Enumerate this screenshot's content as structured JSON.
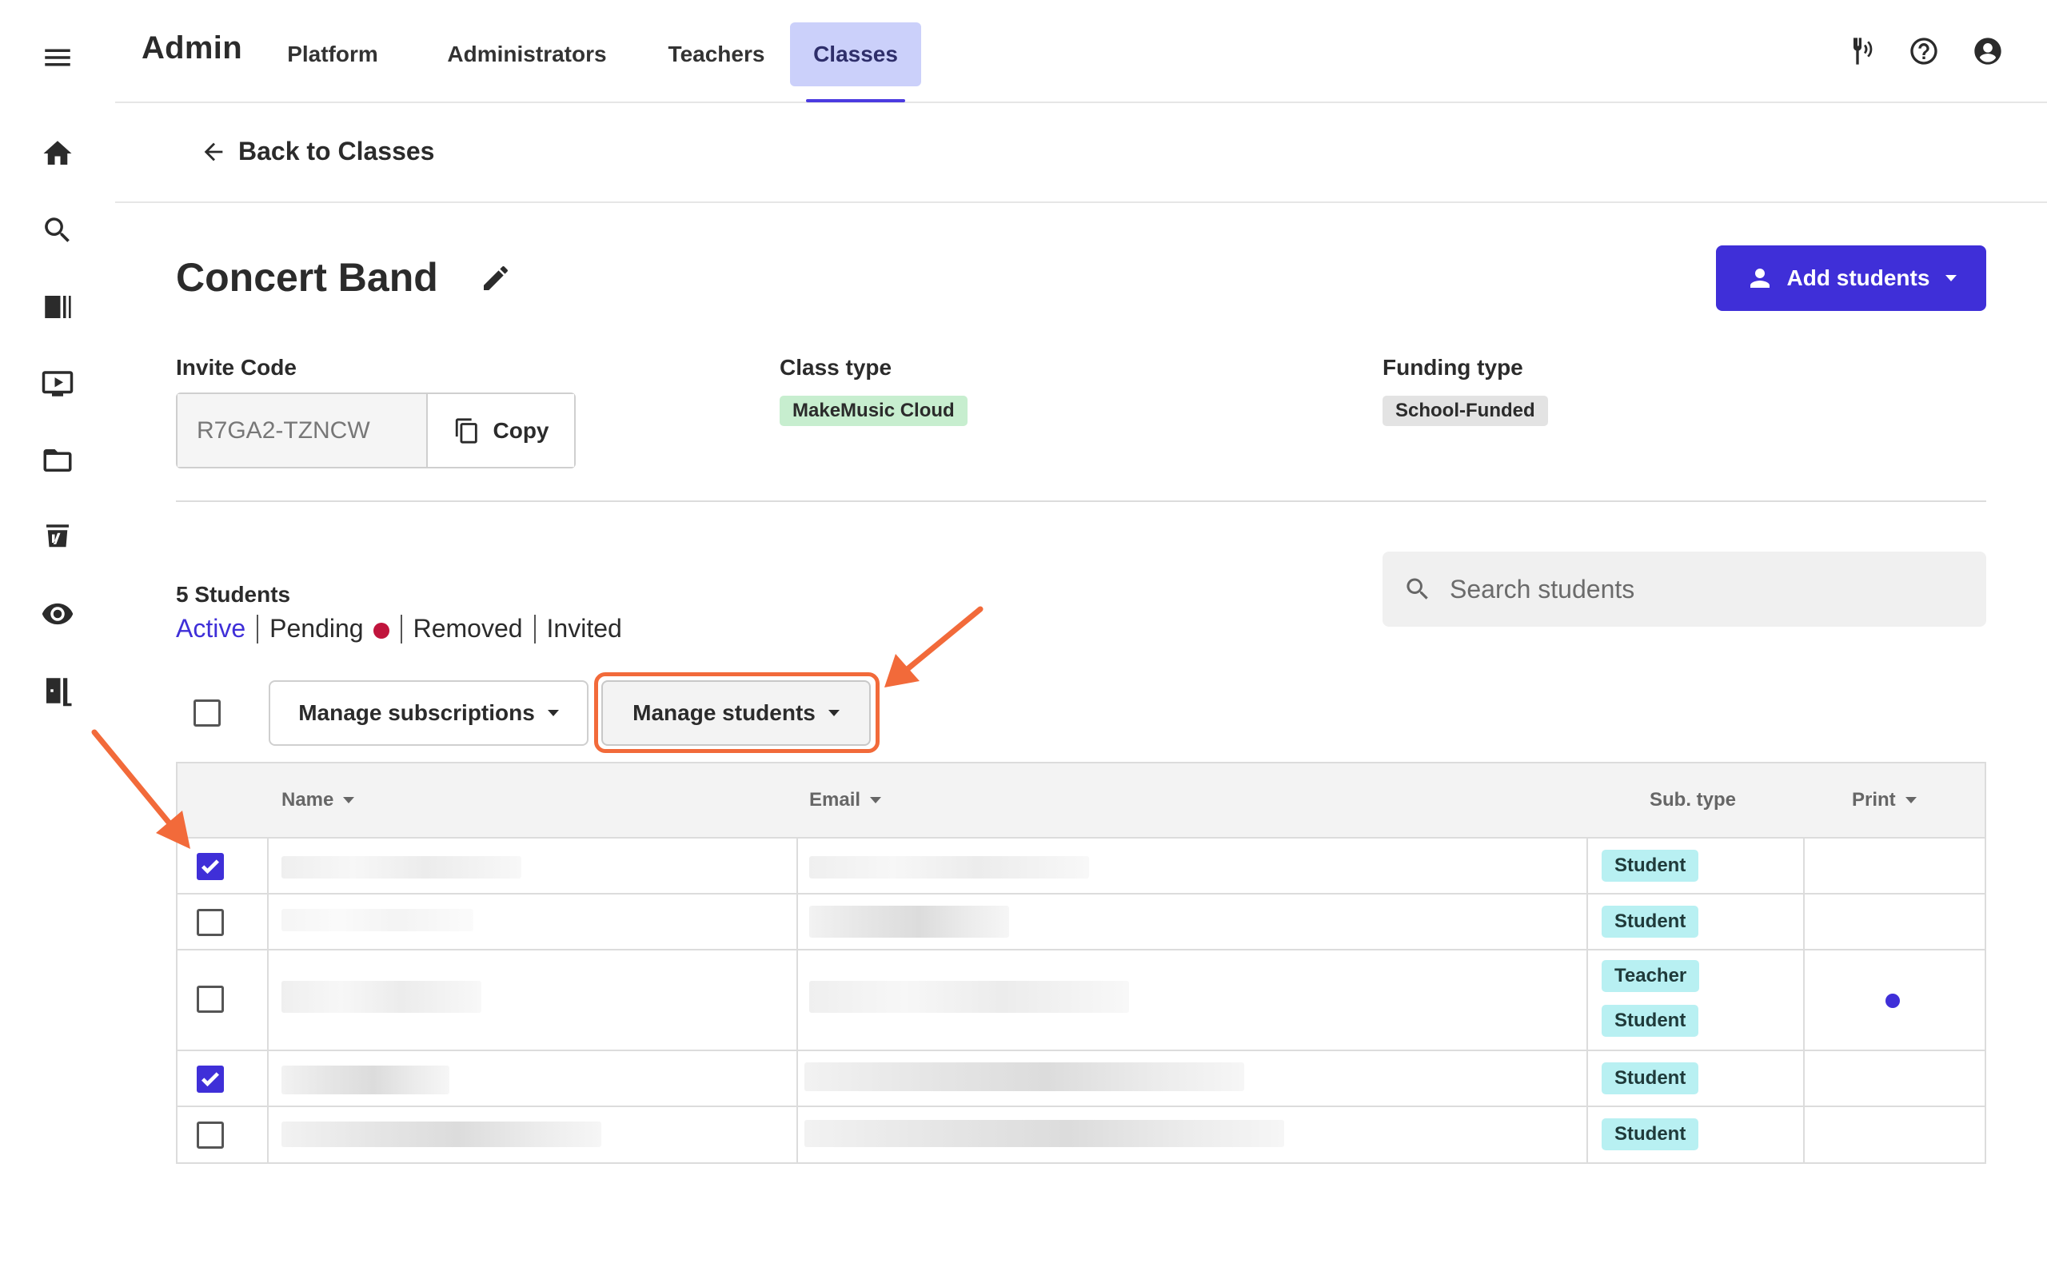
{
  "app": {
    "title": "Admin"
  },
  "nav": {
    "tabs": [
      {
        "label": "Platform"
      },
      {
        "label": "Administrators"
      },
      {
        "label": "Teachers"
      },
      {
        "label": "Classes",
        "active": true
      }
    ]
  },
  "rail": {
    "items": [
      "menu-icon",
      "home-icon",
      "search-icon",
      "library-icon",
      "video-icon",
      "folder-icon",
      "assignment-icon",
      "eye-icon",
      "exit-icon"
    ]
  },
  "top_icons": [
    "tuner-icon",
    "help-icon",
    "account-icon"
  ],
  "back": {
    "label": "Back to Classes"
  },
  "class": {
    "name": "Concert Band",
    "invite_code_label": "Invite Code",
    "invite_code": "R7GA2-TZNCW",
    "copy_label": "Copy",
    "class_type_label": "Class type",
    "class_type": "MakeMusic Cloud",
    "funding_type_label": "Funding type",
    "funding_type": "School-Funded"
  },
  "add_students": {
    "label": "Add students"
  },
  "students": {
    "count_label": "5 Students",
    "filters": [
      "Active",
      "Pending",
      "Removed",
      "Invited"
    ],
    "active_filter": "Active",
    "search_placeholder": "Search students"
  },
  "toolbar": {
    "manage_subscriptions": "Manage subscriptions",
    "manage_students": "Manage students"
  },
  "table": {
    "columns": {
      "name": "Name",
      "email": "Email",
      "sub_type": "Sub. type",
      "print": "Print"
    },
    "rows": [
      {
        "checked": true,
        "sub_types": [
          "Student"
        ],
        "print": false
      },
      {
        "checked": false,
        "sub_types": [
          "Student"
        ],
        "print": false
      },
      {
        "checked": false,
        "sub_types": [
          "Teacher",
          "Student"
        ],
        "print": true
      },
      {
        "checked": true,
        "sub_types": [
          "Student"
        ],
        "print": false
      },
      {
        "checked": false,
        "sub_types": [
          "Student"
        ],
        "print": false
      }
    ]
  },
  "colors": {
    "accent": "#3f2fd8",
    "active_tab_bg": "#cbd0fa",
    "annotation": "#f26a3a",
    "pending_dot": "#c0143c",
    "class_type_bg": "#c7eecf",
    "sub_type_bg": "#b8f0f2"
  }
}
